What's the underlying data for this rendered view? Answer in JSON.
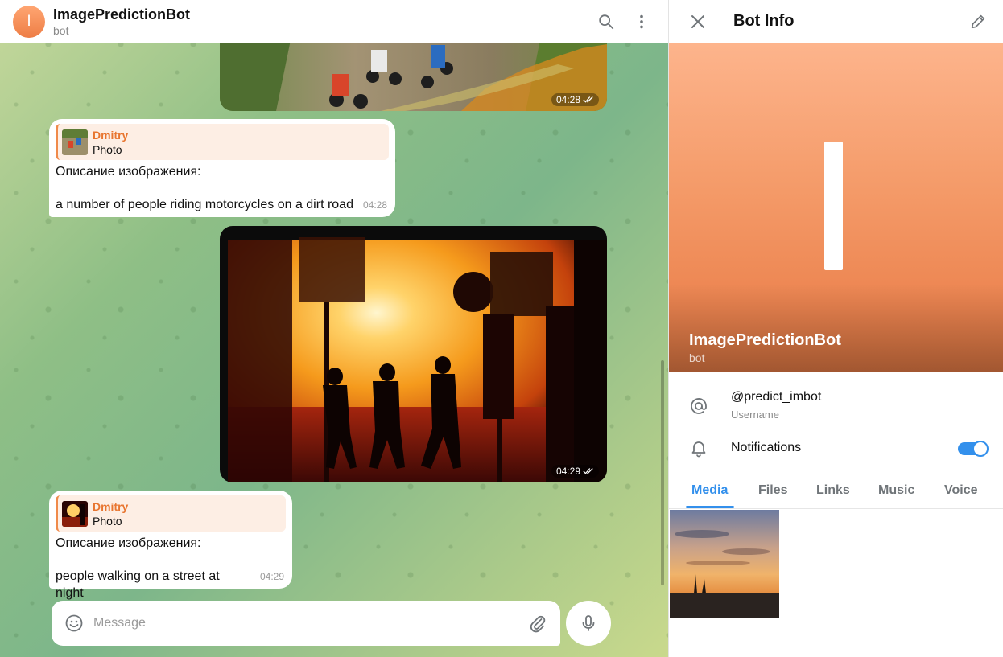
{
  "chat": {
    "title": "ImagePredictionBot",
    "subtitle": "bot",
    "avatar_letter": "I",
    "messages": [
      {
        "kind": "photo",
        "time": "04:28"
      },
      {
        "kind": "reply",
        "reply_name": "Dmitry",
        "reply_type": "Photo",
        "line1": "Описание изображения:",
        "line2": "a number of people riding motorcycles on a dirt road",
        "time": "04:28"
      },
      {
        "kind": "photo",
        "time": "04:29"
      },
      {
        "kind": "reply",
        "reply_name": "Dmitry",
        "reply_type": "Photo",
        "line1": "Описание изображения:",
        "line2": "people walking on a street at night",
        "time": "04:29"
      }
    ],
    "composer": {
      "placeholder": "Message"
    }
  },
  "info": {
    "title": "Bot Info",
    "name": "ImagePredictionBot",
    "subtitle": "bot",
    "username": "@predict_imbot",
    "username_label": "Username",
    "notifications_label": "Notifications",
    "notifications_on": true,
    "tabs": [
      "Media",
      "Files",
      "Links",
      "Music",
      "Voice"
    ],
    "active_tab": "Media"
  },
  "colors": {
    "accent": "#3390ec",
    "reply_name": "#e8752f",
    "avatar": "#ee7d45"
  },
  "icons": [
    "search-icon",
    "more-vertical-icon",
    "close-icon",
    "pencil-icon",
    "at-icon",
    "bell-icon",
    "emoji-icon",
    "attach-icon",
    "mic-icon",
    "double-check-icon"
  ]
}
